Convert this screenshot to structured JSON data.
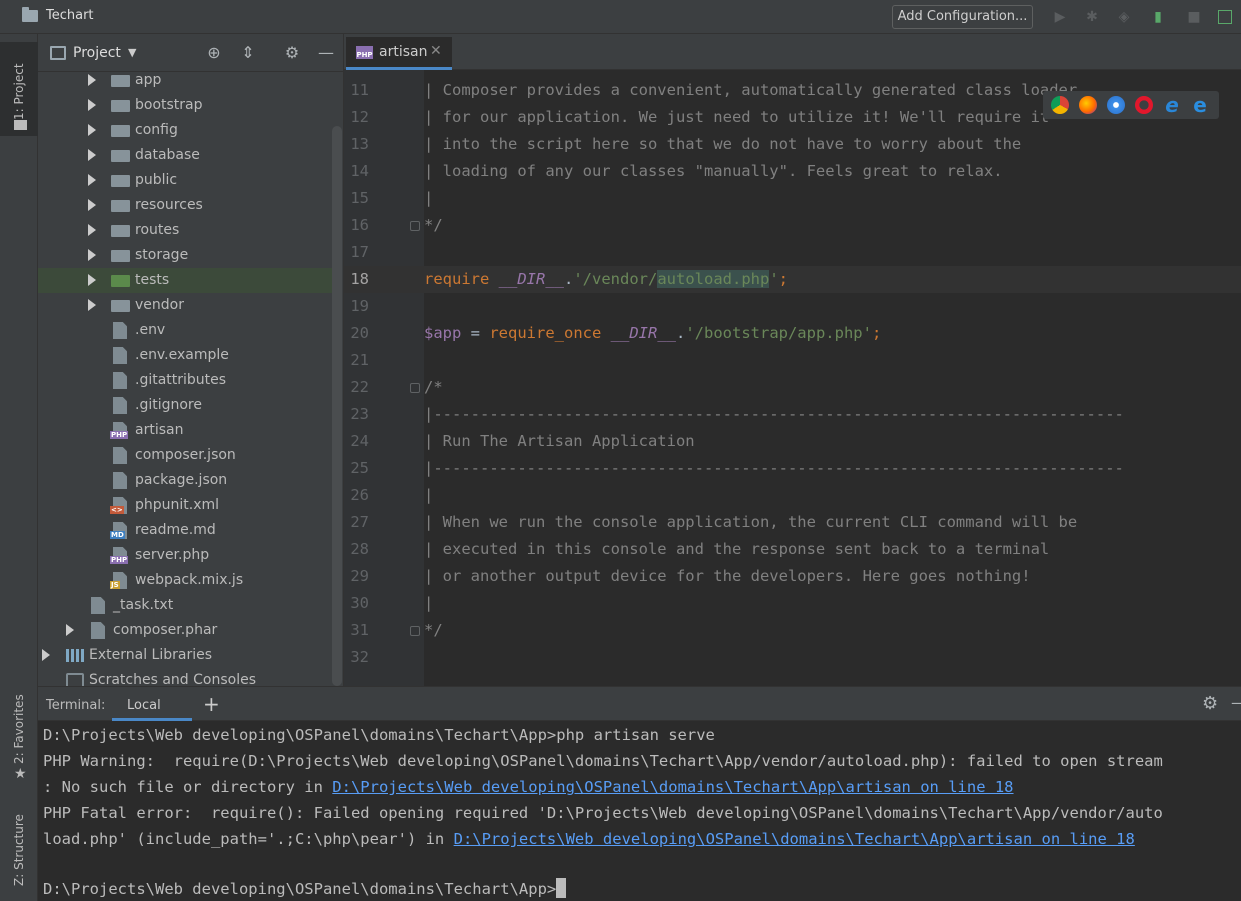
{
  "window": {
    "project_name": "Techart"
  },
  "toolbar": {
    "add_configuration": "Add Configuration..."
  },
  "side_tabs": {
    "project": "1: Project",
    "favorites": "2: Favorites",
    "structure": "Z: Structure"
  },
  "project_panel": {
    "title": "Project",
    "items": [
      {
        "label": "app",
        "kind": "folder",
        "depth": 1
      },
      {
        "label": "bootstrap",
        "kind": "folder",
        "depth": 1
      },
      {
        "label": "config",
        "kind": "folder",
        "depth": 1
      },
      {
        "label": "database",
        "kind": "folder",
        "depth": 1
      },
      {
        "label": "public",
        "kind": "folder",
        "depth": 1
      },
      {
        "label": "resources",
        "kind": "folder",
        "depth": 1
      },
      {
        "label": "routes",
        "kind": "folder",
        "depth": 1
      },
      {
        "label": "storage",
        "kind": "folder",
        "depth": 1
      },
      {
        "label": "tests",
        "kind": "folder-test",
        "depth": 1
      },
      {
        "label": "vendor",
        "kind": "folder",
        "depth": 1
      },
      {
        "label": ".env",
        "kind": "file",
        "depth": 1
      },
      {
        "label": ".env.example",
        "kind": "file",
        "depth": 1
      },
      {
        "label": ".gitattributes",
        "kind": "file",
        "depth": 1
      },
      {
        "label": ".gitignore",
        "kind": "file",
        "depth": 1
      },
      {
        "label": "artisan",
        "kind": "php",
        "depth": 1
      },
      {
        "label": "composer.json",
        "kind": "json",
        "depth": 1
      },
      {
        "label": "package.json",
        "kind": "json",
        "depth": 1
      },
      {
        "label": "phpunit.xml",
        "kind": "xml",
        "depth": 1
      },
      {
        "label": "readme.md",
        "kind": "md",
        "depth": 1
      },
      {
        "label": "server.php",
        "kind": "php",
        "depth": 1
      },
      {
        "label": "webpack.mix.js",
        "kind": "js",
        "depth": 1
      },
      {
        "label": "_task.txt",
        "kind": "file",
        "depth": 0
      },
      {
        "label": "composer.phar",
        "kind": "phar",
        "depth": 0
      },
      {
        "label": "External Libraries",
        "kind": "lib",
        "depth": -1
      },
      {
        "label": "Scratches and Consoles",
        "kind": "scratch",
        "depth": -1
      }
    ],
    "badges": {
      "php": "PHP",
      "md": "MD",
      "js": "JS",
      "xml": "<>"
    }
  },
  "editor": {
    "tab_label": "artisan",
    "current_line": "18",
    "lines": [
      {
        "n": "11",
        "cmt": "| Composer provides a convenient, automatically generated class loader"
      },
      {
        "n": "12",
        "cmt": "| for our application. We just need to utilize it! We'll require it"
      },
      {
        "n": "13",
        "cmt": "| into the script here so that we do not have to worry about the"
      },
      {
        "n": "14",
        "cmt": "| loading of any our classes \"manually\". Feels great to relax."
      },
      {
        "n": "15",
        "cmt": "|"
      },
      {
        "n": "16",
        "cmt": "*/"
      },
      {
        "n": "17",
        "cmt": ""
      },
      {
        "n": "18"
      },
      {
        "n": "19",
        "cmt": ""
      },
      {
        "n": "20"
      },
      {
        "n": "21",
        "cmt": ""
      },
      {
        "n": "22",
        "cmt": "/*"
      },
      {
        "n": "23",
        "cmt": "|--------------------------------------------------------------------------"
      },
      {
        "n": "24",
        "cmt": "| Run The Artisan Application"
      },
      {
        "n": "25",
        "cmt": "|--------------------------------------------------------------------------"
      },
      {
        "n": "26",
        "cmt": "|"
      },
      {
        "n": "27",
        "cmt": "| When we run the console application, the current CLI command will be"
      },
      {
        "n": "28",
        "cmt": "| executed in this console and the response sent back to a terminal"
      },
      {
        "n": "29",
        "cmt": "| or another output device for the developers. Here goes nothing!"
      },
      {
        "n": "30",
        "cmt": "|"
      },
      {
        "n": "31",
        "cmt": "*/"
      },
      {
        "n": "32",
        "cmt": ""
      }
    ],
    "line18": {
      "kw": "require",
      "const": "__DIR__",
      "dot": ".",
      "str_a": "'/vendor/",
      "str_hl": "autoload.php",
      "str_b": "'",
      "semi": ";"
    },
    "line20": {
      "var": "$app",
      "eq": " = ",
      "kw": "require_once",
      "const": "__DIR__",
      "dot": ".",
      "str": "'/bootstrap/app.php'",
      "semi": ";"
    }
  },
  "browsers": [
    "chrome-icon",
    "firefox-icon",
    "safari-icon",
    "opera-icon",
    "ie-icon",
    "edge-icon"
  ],
  "terminal": {
    "title": "Terminal:",
    "tab": "Local",
    "add": "+",
    "line1": "D:\\Projects\\Web developing\\OSPanel\\domains\\Techart\\App>php artisan serve",
    "line2": "PHP Warning:  require(D:\\Projects\\Web developing\\OSPanel\\domains\\Techart\\App/vendor/autoload.php): failed to open stream",
    "line3_text": ": No such file or directory in ",
    "line3_link": "D:\\Projects\\Web developing\\OSPanel\\domains\\Techart\\App\\artisan on line 18",
    "line4": "PHP Fatal error:  require(): Failed opening required 'D:\\Projects\\Web developing\\OSPanel\\domains\\Techart\\App/vendor/auto",
    "line5_text": "load.php' (include_path='.;C:\\php\\pear') in ",
    "line5_link": "D:\\Projects\\Web developing\\OSPanel\\domains\\Techart\\App\\artisan on line 18",
    "line6": "D:\\Projects\\Web developing\\OSPanel\\domains\\Techart\\App>"
  }
}
